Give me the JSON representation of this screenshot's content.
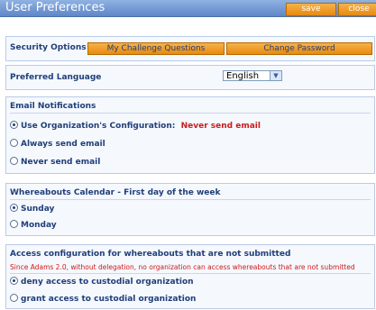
{
  "window": {
    "title": "User Preferences",
    "save_label": "save",
    "close_label": "close"
  },
  "security": {
    "title": "Security Options",
    "challenge_label": "My Challenge Questions",
    "change_password_label": "Change Password"
  },
  "language": {
    "title": "Preferred Language",
    "selected": "English",
    "dropdown_icon": "chevron-down-icon"
  },
  "notifications": {
    "title": "Email Notifications",
    "options": [
      {
        "label": "Use Organization's Configuration:",
        "suffix": "Never send email",
        "checked": true
      },
      {
        "label": "Always send email",
        "checked": false
      },
      {
        "label": "Never send email",
        "checked": false
      }
    ]
  },
  "calendar": {
    "title": "Whereabouts Calendar - First day of the week",
    "options": [
      {
        "label": "Sunday",
        "checked": true
      },
      {
        "label": "Monday",
        "checked": false
      }
    ]
  },
  "access": {
    "title": "Access configuration for whereabouts that are not submitted",
    "note": "Since Adams 2.0, without delegation, no organization can access whereabouts that are not submitted",
    "options": [
      {
        "label": "deny access to custodial organization",
        "checked": true
      },
      {
        "label": "grant access to custodial organization",
        "checked": false
      }
    ]
  },
  "colors": {
    "accent_orange": "#f0a030",
    "title_bar_blue": "#6f95d2",
    "text_blue": "#1f3f7a",
    "warning_red": "#cc1b1b"
  }
}
